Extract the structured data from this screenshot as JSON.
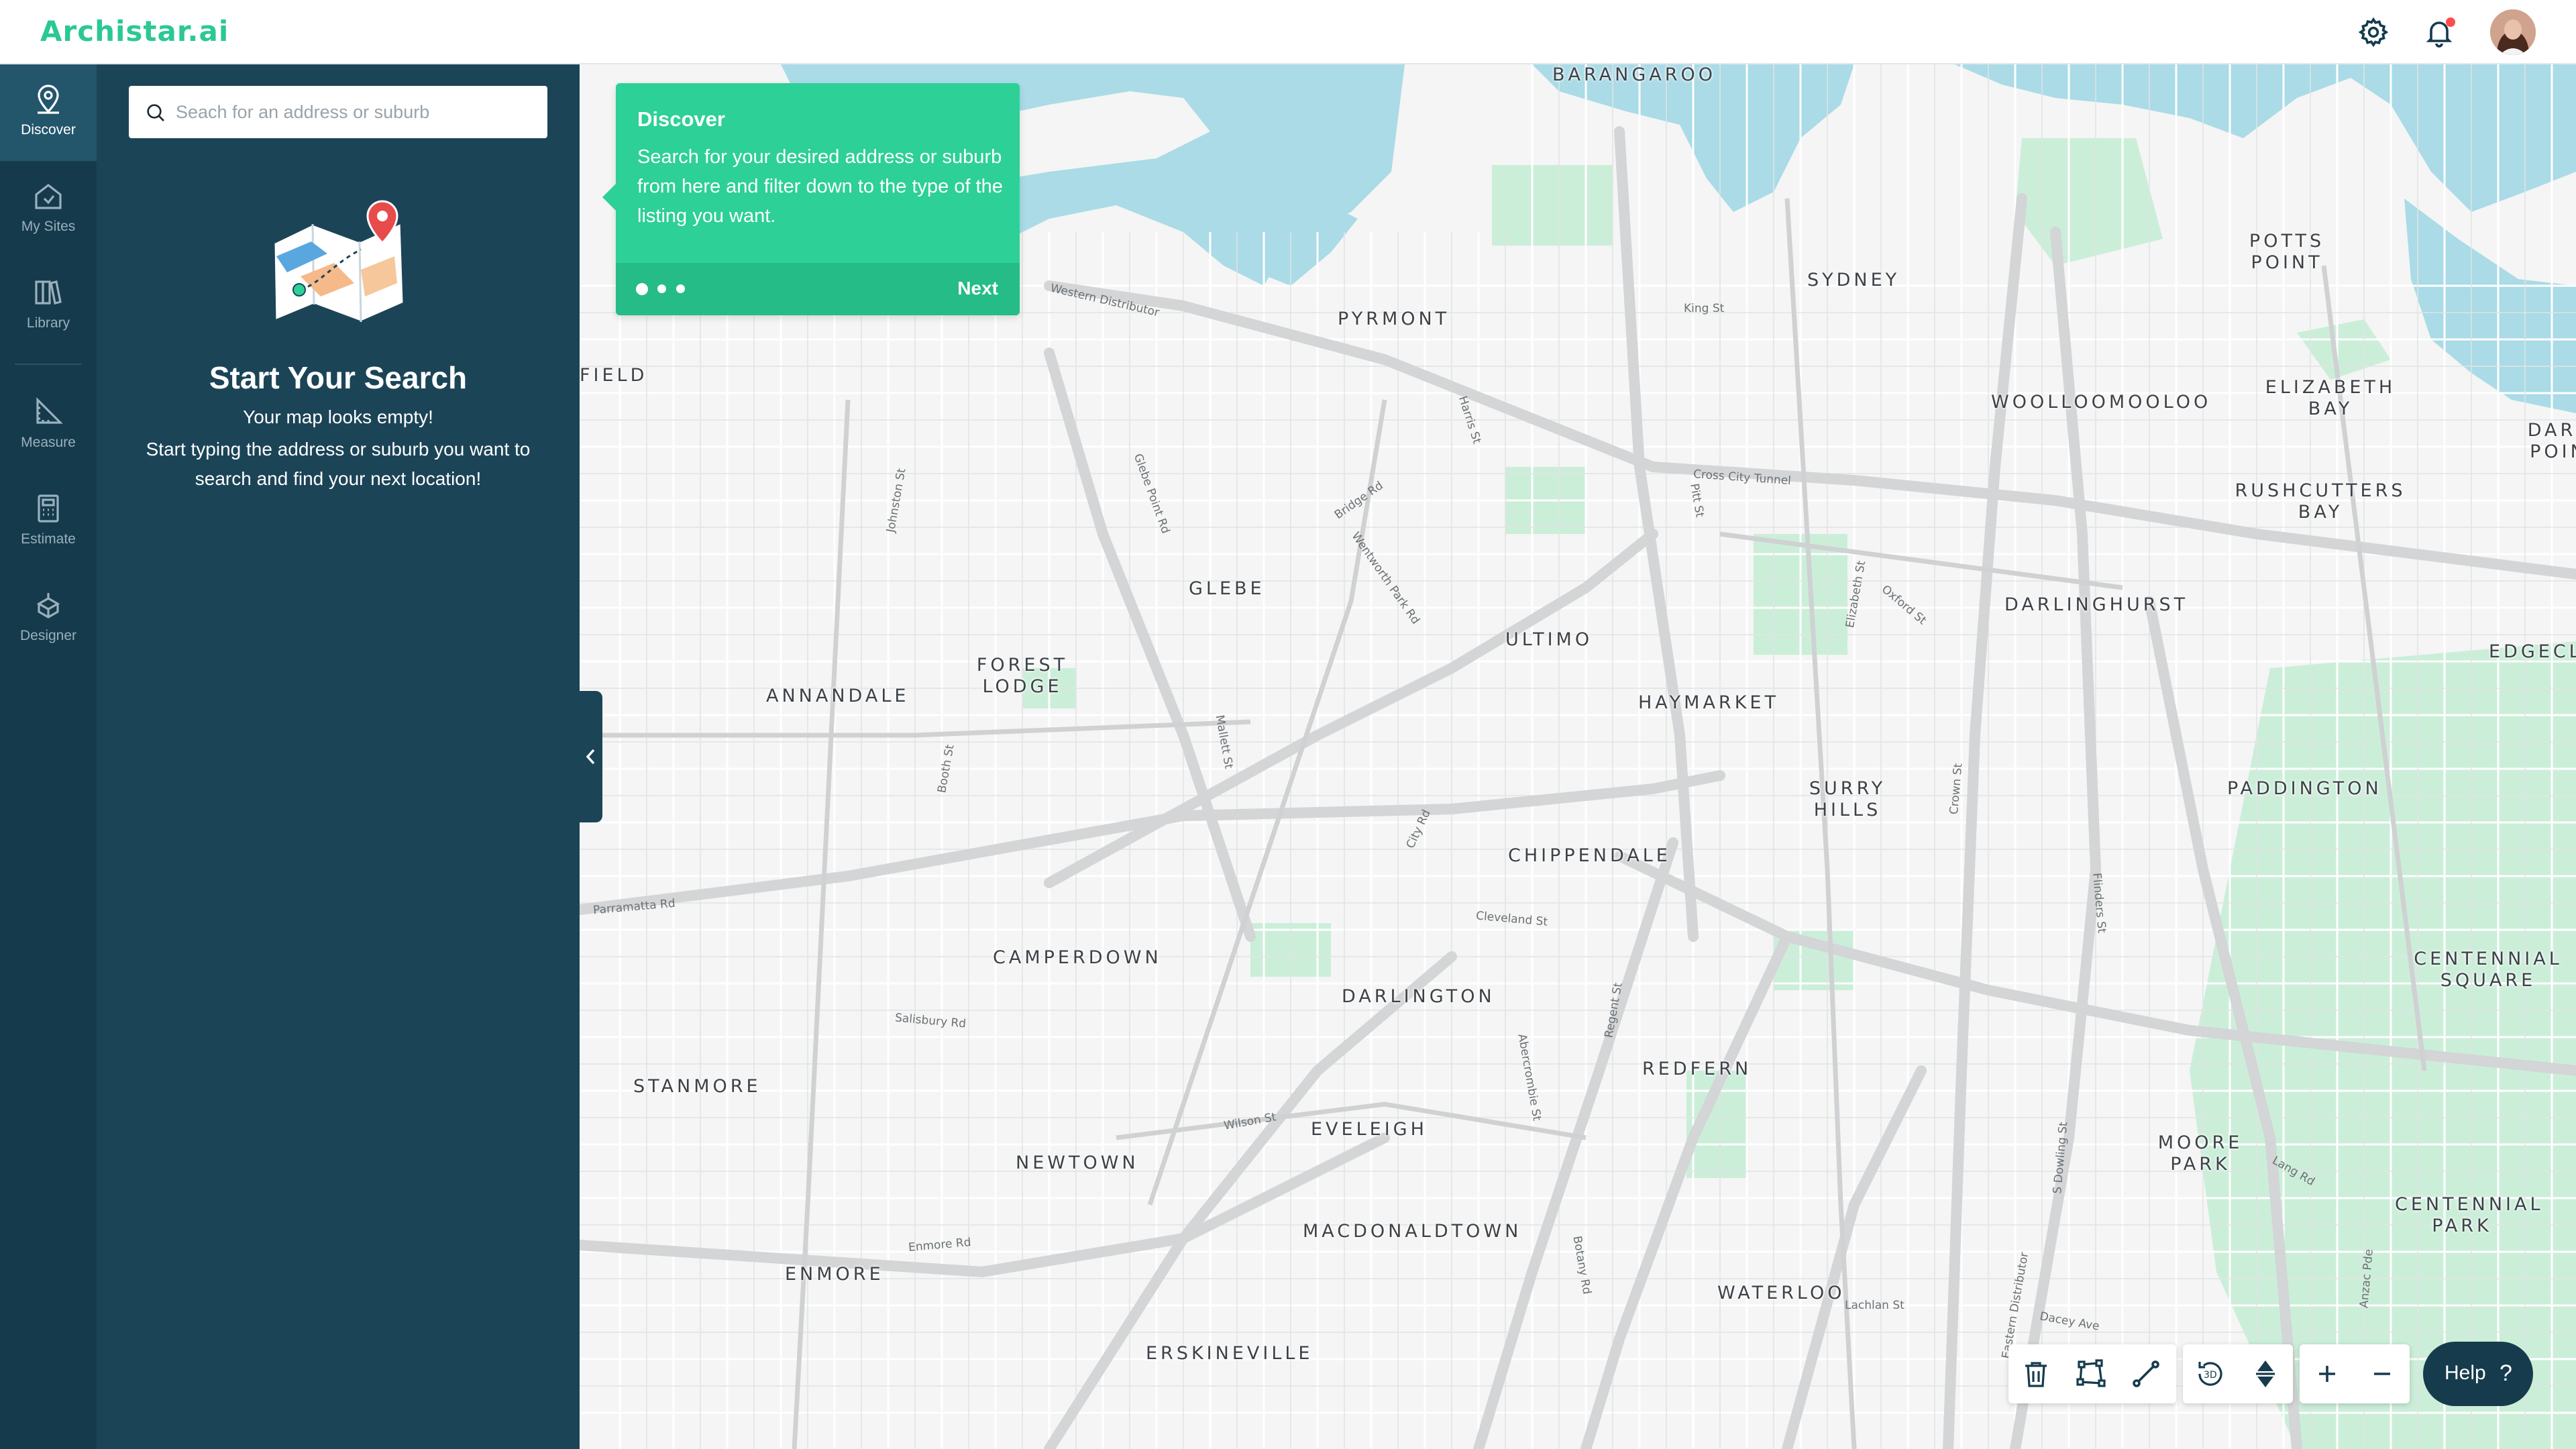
{
  "app": {
    "logo_text": "Archistar.ai",
    "brand_color": "#2bc896"
  },
  "header": {
    "icons": [
      "gear-icon",
      "bell-icon",
      "avatar"
    ],
    "notification_dot_color": "#ff4b4b"
  },
  "nav": {
    "items": [
      {
        "label": "Discover",
        "icon": "map-pin-icon",
        "active": true
      },
      {
        "label": "My Sites",
        "icon": "home-icon",
        "active": false
      },
      {
        "label": "Library",
        "icon": "library-icon",
        "active": false
      },
      {
        "label": "Measure",
        "icon": "ruler-icon",
        "active": false
      },
      {
        "label": "Estimate",
        "icon": "calculator-icon",
        "active": false
      },
      {
        "label": "Designer",
        "icon": "designer-icon",
        "active": false
      }
    ]
  },
  "panel": {
    "search_placeholder": "Seach for an address or suburb",
    "empty_title": "Start Your Search",
    "empty_subtitle": "Your map looks empty!",
    "empty_description": "Start typing the address or suburb you want to search and find your next location!"
  },
  "tour": {
    "title": "Discover",
    "body": "Search for your desired address or suburb from here and filter down to the type of the listing you want.",
    "next_label": "Next",
    "steps": 3,
    "current_step": 1
  },
  "map": {
    "suburbs": [
      "BARANGAROO",
      "PYRMONT",
      "SYDNEY",
      "POTTS POINT",
      "FIELD",
      "WOOLLOOMOOLOO",
      "ELIZABETH BAY",
      "DARL POIN",
      "RUSHCUTTERS BAY",
      "GLEBE",
      "ULTIMO",
      "DARLINGHURST",
      "FOREST LODGE",
      "ANNANDALE",
      "HAYMARKET",
      "EDGECLIFF",
      "SURRY HILLS",
      "PADDINGTON",
      "CHIPPENDALE",
      "CAMPERDOWN",
      "DARLINGTON",
      "CENTENNIAL SQUARE",
      "STANMORE",
      "REDFERN",
      "EVELEIGH",
      "MOORE PARK",
      "NEWTOWN",
      "MACDONALDTOWN",
      "CENTENNIAL PARK",
      "ENMORE",
      "WATERLOO",
      "ERSKINEVILLE"
    ],
    "streets": [
      "Western Distributor",
      "Bridge Rd",
      "Cross City Tunnel",
      "Parramatta Rd",
      "Cleveland St",
      "Oxford St",
      "Elizabeth St",
      "Crown St",
      "Pitt St",
      "Wentworth Park Rd",
      "Harris St",
      "City Rd",
      "King St",
      "Enmore Rd",
      "Glebe Point Rd",
      "Johnston St",
      "S Dowling St",
      "Eastern Distributor",
      "Botany Rd",
      "Regent St",
      "Abercrombie St",
      "Wilson St",
      "Lachlan St",
      "Dacey Ave",
      "Lang Rd",
      "Flinders St",
      "Anzac Pde",
      "Booth St",
      "Salisbury Rd",
      "Mallett St"
    ]
  },
  "toolbar": {
    "tools": [
      "trash-icon",
      "polygon-icon",
      "line-measure-icon",
      "rotate-3d-icon",
      "height-icon"
    ],
    "zoom": [
      "plus-icon",
      "minus-icon"
    ],
    "label_3d": "3D"
  },
  "help": {
    "label": "Help",
    "glyph": "?"
  },
  "colors": {
    "nav_bg": "#153a4c",
    "panel_bg": "#1c4457",
    "tour_bg": "#2dd097",
    "water": "#aadbe7",
    "park": "#cbeed9"
  }
}
